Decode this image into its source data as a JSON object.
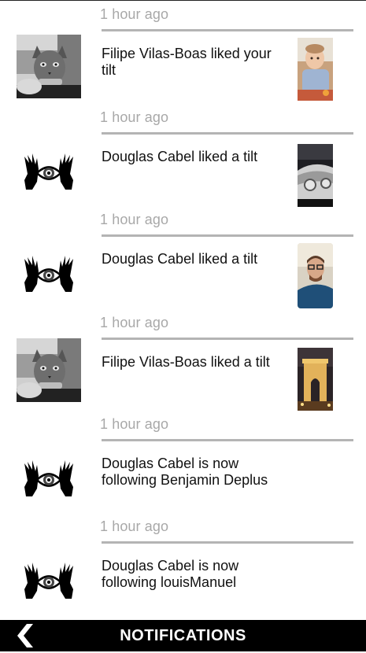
{
  "header": {
    "title": "NOTIFICATIONS"
  },
  "icons": {
    "back": "chevron-left-icon",
    "cat_avatar": "cat-photo-avatar",
    "eye_hands_avatar": "eye-hands-logo-avatar"
  },
  "notifications": [
    {
      "time": "1 hour ago",
      "text": "Filipe Vilas-Boas liked your tilt",
      "avatar": "cat-photo-avatar",
      "thumbnail": "baby-photo"
    },
    {
      "time": "1 hour ago",
      "text": "Douglas Cabel liked a tilt",
      "avatar": "eye-hands-logo-avatar",
      "thumbnail": "car-photo"
    },
    {
      "time": "1 hour ago",
      "text": "Douglas Cabel liked a tilt",
      "avatar": "eye-hands-logo-avatar",
      "thumbnail": "man-with-glasses-photo"
    },
    {
      "time": "1 hour ago",
      "text": "Filipe Vilas-Boas liked a tilt",
      "avatar": "cat-photo-avatar",
      "thumbnail": "arc-de-triomphe-night-photo"
    },
    {
      "time": "1 hour ago",
      "text": "Douglas Cabel is now following Benjamin Deplus",
      "avatar": "eye-hands-logo-avatar",
      "thumbnail": null
    },
    {
      "time": "1 hour ago",
      "text": "Douglas Cabel is now following louisManuel",
      "avatar": "eye-hands-logo-avatar",
      "thumbnail": null
    }
  ]
}
